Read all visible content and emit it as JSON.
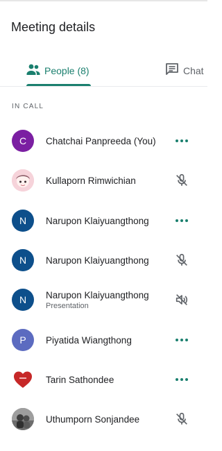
{
  "header": {
    "title": "Meeting details"
  },
  "tabs": [
    {
      "label": "People (8)",
      "icon": "people-icon",
      "active": true
    },
    {
      "label": "Chat",
      "icon": "chat-icon",
      "active": false
    }
  ],
  "section": {
    "label": "IN CALL"
  },
  "participants": [
    {
      "name": "Chatchai Panpreeda (You)",
      "initial": "C",
      "avatar_color": "#7b1fa2",
      "action": "more-options-icon"
    },
    {
      "name": "Kullaporn Rimwichian",
      "initial": "",
      "avatar_color": "#f3c6cf",
      "action": "mic-off-icon"
    },
    {
      "name": "Narupon Klaiyuangthong",
      "initial": "N",
      "avatar_color": "#0d4f8b",
      "action": "more-options-icon"
    },
    {
      "name": "Narupon Klaiyuangthong",
      "initial": "N",
      "avatar_color": "#0d4f8b",
      "action": "mic-off-icon"
    },
    {
      "name": "Narupon Klaiyuangthong",
      "sub": "Presentation",
      "initial": "N",
      "avatar_color": "#0d4f8b",
      "action": "volume-off-icon"
    },
    {
      "name": "Piyatida Wiangthong",
      "initial": "P",
      "avatar_color": "#5c6bc0",
      "action": "more-options-icon"
    },
    {
      "name": "Tarin Sathondee",
      "initial": "",
      "avatar_color": "#c62828",
      "action": "more-options-icon"
    },
    {
      "name": "Uthumporn Sonjandee",
      "initial": "",
      "avatar_color": "#8d8d8d",
      "action": "mic-off-icon"
    }
  ],
  "colors": {
    "accent": "#1a7f6e",
    "icon_gray": "#5f6368"
  }
}
